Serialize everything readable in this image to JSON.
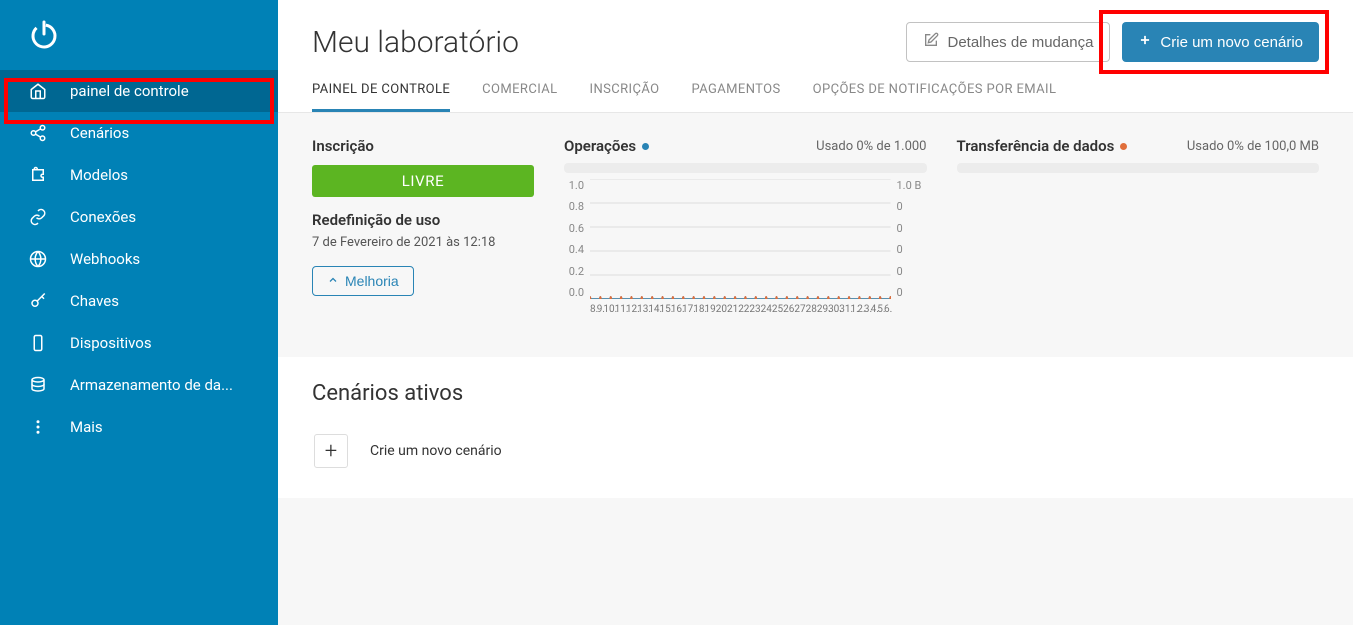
{
  "sidebar": {
    "items": [
      {
        "label": "painel de controle",
        "icon": "home-icon",
        "active": true
      },
      {
        "label": "Cenários",
        "icon": "share-icon"
      },
      {
        "label": "Modelos",
        "icon": "puzzle-icon"
      },
      {
        "label": "Conexões",
        "icon": "link-icon"
      },
      {
        "label": "Webhooks",
        "icon": "globe-icon"
      },
      {
        "label": "Chaves",
        "icon": "key-icon"
      },
      {
        "label": "Dispositivos",
        "icon": "device-icon"
      },
      {
        "label": "Armazenamento de da...",
        "icon": "storage-icon"
      },
      {
        "label": "Mais",
        "icon": "more-icon"
      }
    ]
  },
  "header": {
    "title": "Meu laboratório",
    "btn_details": "Detalhes de mudança",
    "btn_create": "Crie um novo cenário"
  },
  "tabs": [
    {
      "label": "PAINEL DE CONTROLE",
      "active": true
    },
    {
      "label": "COMERCIAL"
    },
    {
      "label": "INSCRIÇÃO"
    },
    {
      "label": "PAGAMENTOS"
    },
    {
      "label": "OPÇÕES DE NOTIFICAÇÕES POR EMAIL"
    }
  ],
  "subscription": {
    "title": "Inscrição",
    "plan": "LIVRE",
    "reset_title": "Redefinição de uso",
    "reset_date": "7 de Fevereiro de 2021 às 12:18",
    "upgrade": "Melhoria"
  },
  "operations": {
    "title": "Operações",
    "usage": "Usado 0% de 1.000"
  },
  "transfer": {
    "title": "Transferência de dados",
    "usage": "Usado 0% de 100,0 MB"
  },
  "scenarios": {
    "section_title": "Cenários ativos",
    "create_label": "Crie um novo cenário"
  },
  "chart_data": {
    "type": "line",
    "x": [
      "8.",
      "9.",
      "10.",
      "11.",
      "12.",
      "13.",
      "14.",
      "15.",
      "16.",
      "17.",
      "18.",
      "19.",
      "20.",
      "21.",
      "22.",
      "23.",
      "24.",
      "25.",
      "26.",
      "27.",
      "28.",
      "29.",
      "30.",
      "31.",
      "1.",
      "2.",
      "3.",
      "4.",
      "5.",
      "6."
    ],
    "series": [
      {
        "name": "Operações",
        "color": "#2984b5",
        "values": [
          0,
          0,
          0,
          0,
          0,
          0,
          0,
          0,
          0,
          0,
          0,
          0,
          0,
          0,
          0,
          0,
          0,
          0,
          0,
          0,
          0,
          0,
          0,
          0,
          0,
          0,
          0,
          0,
          0,
          0
        ]
      },
      {
        "name": "Transferência de dados",
        "color": "#e06e3b",
        "values": [
          0,
          0,
          0,
          0,
          0,
          0,
          0,
          0,
          0,
          0,
          0,
          0,
          0,
          0,
          0,
          0,
          0,
          0,
          0,
          0,
          0,
          0,
          0,
          0,
          0,
          0,
          0,
          0,
          0,
          0
        ]
      }
    ],
    "y_left_ticks": [
      "1.0",
      "0.8",
      "0.6",
      "0.4",
      "0.2",
      "0.0"
    ],
    "y_right_ticks": [
      "1.0 B",
      "0",
      "0",
      "0",
      "0",
      "0"
    ],
    "ylim": [
      0,
      1
    ]
  }
}
